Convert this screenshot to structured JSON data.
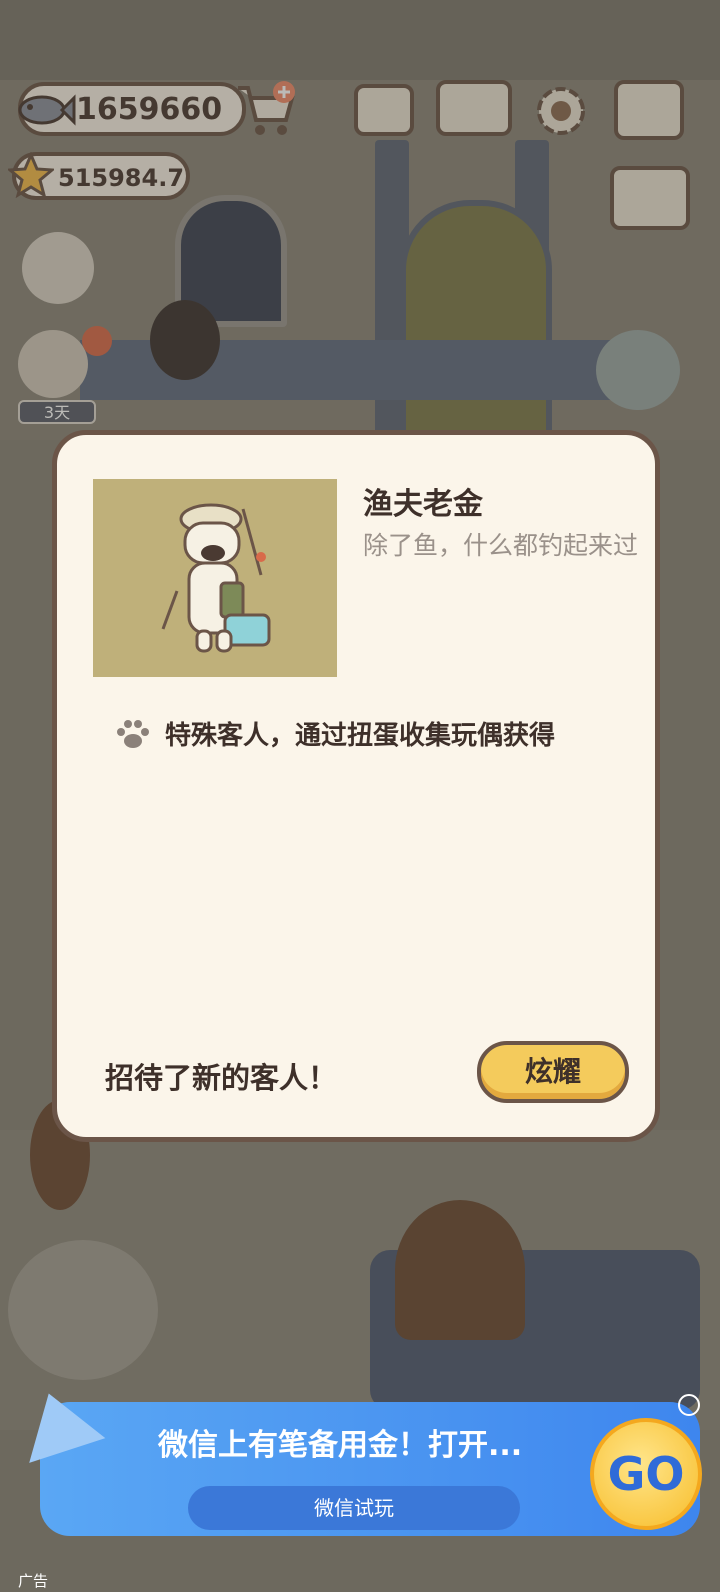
{
  "hud": {
    "fish_count": "1659660",
    "star_count": "515984.7",
    "days_badge": "3天",
    "icons": [
      "fish-icon",
      "shopping-cart-icon",
      "menu-card-icon",
      "guest-book-icon",
      "gear-icon",
      "map-icon",
      "star-icon",
      "sort-icon",
      "alert-icon"
    ]
  },
  "modal": {
    "guest_name": "渔夫老金",
    "guest_desc": "除了鱼，什么都钓起来过",
    "unlock_hint": "特殊客人，通过扭蛋收集玩偶获得",
    "footer_message": "招待了新的客人！",
    "brag_button": "炫耀"
  },
  "ad": {
    "title": "微信上有笔备用金！打开...",
    "button": "微信试玩",
    "go_label": "GO",
    "label": "广告"
  },
  "colors": {
    "modal_bg": "#fbf5ea",
    "border": "#6b5548",
    "button_yellow": "#f4cb5c",
    "ad_blue": "#3e86ee"
  }
}
